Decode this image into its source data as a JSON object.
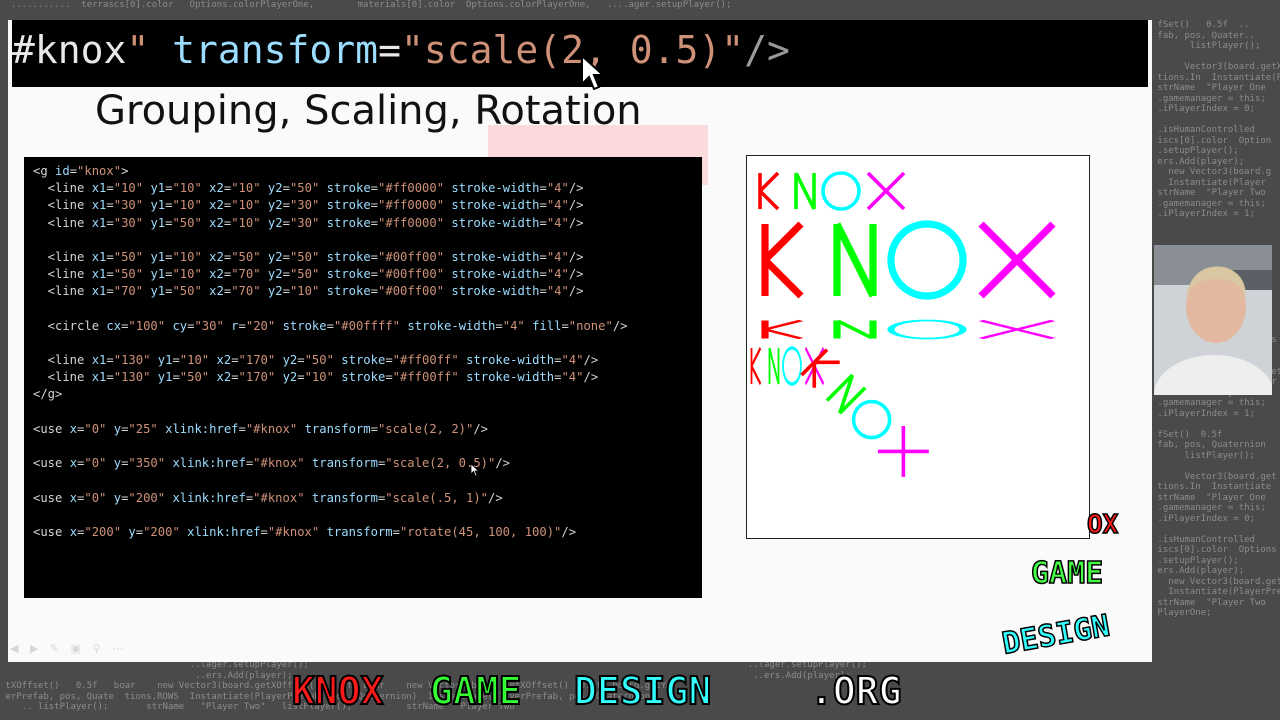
{
  "zoom": {
    "text_parts": [
      "#knox",
      "\"",
      " transform",
      "=",
      "\"scale(2, 0.5)\"",
      "/>"
    ]
  },
  "slide": {
    "title": "Grouping, Scaling, Rotation"
  },
  "code_lines": [
    [
      [
        "t",
        "<g "
      ],
      [
        "a",
        "id"
      ],
      [
        "t",
        "="
      ],
      [
        "s",
        "\"knox\""
      ],
      [
        "t",
        ">"
      ]
    ],
    [
      [
        "t",
        "  <line "
      ],
      [
        "a",
        "x1"
      ],
      [
        "t",
        "="
      ],
      [
        "s",
        "\"10\""
      ],
      [
        "t",
        " "
      ],
      [
        "a",
        "y1"
      ],
      [
        "t",
        "="
      ],
      [
        "s",
        "\"10\""
      ],
      [
        "t",
        " "
      ],
      [
        "a",
        "x2"
      ],
      [
        "t",
        "="
      ],
      [
        "s",
        "\"10\""
      ],
      [
        "t",
        " "
      ],
      [
        "a",
        "y2"
      ],
      [
        "t",
        "="
      ],
      [
        "s",
        "\"50\""
      ],
      [
        "t",
        " "
      ],
      [
        "a",
        "stroke"
      ],
      [
        "t",
        "="
      ],
      [
        "s",
        "\"#ff0000\""
      ],
      [
        "t",
        " "
      ],
      [
        "a",
        "stroke-width"
      ],
      [
        "t",
        "="
      ],
      [
        "s",
        "\"4\""
      ],
      [
        "t",
        "/>"
      ]
    ],
    [
      [
        "t",
        "  <line "
      ],
      [
        "a",
        "x1"
      ],
      [
        "t",
        "="
      ],
      [
        "s",
        "\"30\""
      ],
      [
        "t",
        " "
      ],
      [
        "a",
        "y1"
      ],
      [
        "t",
        "="
      ],
      [
        "s",
        "\"10\""
      ],
      [
        "t",
        " "
      ],
      [
        "a",
        "x2"
      ],
      [
        "t",
        "="
      ],
      [
        "s",
        "\"10\""
      ],
      [
        "t",
        " "
      ],
      [
        "a",
        "y2"
      ],
      [
        "t",
        "="
      ],
      [
        "s",
        "\"30\""
      ],
      [
        "t",
        " "
      ],
      [
        "a",
        "stroke"
      ],
      [
        "t",
        "="
      ],
      [
        "s",
        "\"#ff0000\""
      ],
      [
        "t",
        " "
      ],
      [
        "a",
        "stroke-width"
      ],
      [
        "t",
        "="
      ],
      [
        "s",
        "\"4\""
      ],
      [
        "t",
        "/>"
      ]
    ],
    [
      [
        "t",
        "  <line "
      ],
      [
        "a",
        "x1"
      ],
      [
        "t",
        "="
      ],
      [
        "s",
        "\"30\""
      ],
      [
        "t",
        " "
      ],
      [
        "a",
        "y1"
      ],
      [
        "t",
        "="
      ],
      [
        "s",
        "\"50\""
      ],
      [
        "t",
        " "
      ],
      [
        "a",
        "x2"
      ],
      [
        "t",
        "="
      ],
      [
        "s",
        "\"10\""
      ],
      [
        "t",
        " "
      ],
      [
        "a",
        "y2"
      ],
      [
        "t",
        "="
      ],
      [
        "s",
        "\"30\""
      ],
      [
        "t",
        " "
      ],
      [
        "a",
        "stroke"
      ],
      [
        "t",
        "="
      ],
      [
        "s",
        "\"#ff0000\""
      ],
      [
        "t",
        " "
      ],
      [
        "a",
        "stroke-width"
      ],
      [
        "t",
        "="
      ],
      [
        "s",
        "\"4\""
      ],
      [
        "t",
        "/>"
      ]
    ],
    [],
    [
      [
        "t",
        "  <line "
      ],
      [
        "a",
        "x1"
      ],
      [
        "t",
        "="
      ],
      [
        "s",
        "\"50\""
      ],
      [
        "t",
        " "
      ],
      [
        "a",
        "y1"
      ],
      [
        "t",
        "="
      ],
      [
        "s",
        "\"10\""
      ],
      [
        "t",
        " "
      ],
      [
        "a",
        "x2"
      ],
      [
        "t",
        "="
      ],
      [
        "s",
        "\"50\""
      ],
      [
        "t",
        " "
      ],
      [
        "a",
        "y2"
      ],
      [
        "t",
        "="
      ],
      [
        "s",
        "\"50\""
      ],
      [
        "t",
        " "
      ],
      [
        "a",
        "stroke"
      ],
      [
        "t",
        "="
      ],
      [
        "s",
        "\"#00ff00\""
      ],
      [
        "t",
        " "
      ],
      [
        "a",
        "stroke-width"
      ],
      [
        "t",
        "="
      ],
      [
        "s",
        "\"4\""
      ],
      [
        "t",
        "/>"
      ]
    ],
    [
      [
        "t",
        "  <line "
      ],
      [
        "a",
        "x1"
      ],
      [
        "t",
        "="
      ],
      [
        "s",
        "\"50\""
      ],
      [
        "t",
        " "
      ],
      [
        "a",
        "y1"
      ],
      [
        "t",
        "="
      ],
      [
        "s",
        "\"10\""
      ],
      [
        "t",
        " "
      ],
      [
        "a",
        "x2"
      ],
      [
        "t",
        "="
      ],
      [
        "s",
        "\"70\""
      ],
      [
        "t",
        " "
      ],
      [
        "a",
        "y2"
      ],
      [
        "t",
        "="
      ],
      [
        "s",
        "\"50\""
      ],
      [
        "t",
        " "
      ],
      [
        "a",
        "stroke"
      ],
      [
        "t",
        "="
      ],
      [
        "s",
        "\"#00ff00\""
      ],
      [
        "t",
        " "
      ],
      [
        "a",
        "stroke-width"
      ],
      [
        "t",
        "="
      ],
      [
        "s",
        "\"4\""
      ],
      [
        "t",
        "/>"
      ]
    ],
    [
      [
        "t",
        "  <line "
      ],
      [
        "a",
        "x1"
      ],
      [
        "t",
        "="
      ],
      [
        "s",
        "\"70\""
      ],
      [
        "t",
        " "
      ],
      [
        "a",
        "y1"
      ],
      [
        "t",
        "="
      ],
      [
        "s",
        "\"50\""
      ],
      [
        "t",
        " "
      ],
      [
        "a",
        "x2"
      ],
      [
        "t",
        "="
      ],
      [
        "s",
        "\"70\""
      ],
      [
        "t",
        " "
      ],
      [
        "a",
        "y2"
      ],
      [
        "t",
        "="
      ],
      [
        "s",
        "\"10\""
      ],
      [
        "t",
        " "
      ],
      [
        "a",
        "stroke"
      ],
      [
        "t",
        "="
      ],
      [
        "s",
        "\"#00ff00\""
      ],
      [
        "t",
        " "
      ],
      [
        "a",
        "stroke-width"
      ],
      [
        "t",
        "="
      ],
      [
        "s",
        "\"4\""
      ],
      [
        "t",
        "/>"
      ]
    ],
    [],
    [
      [
        "t",
        "  <circle "
      ],
      [
        "a",
        "cx"
      ],
      [
        "t",
        "="
      ],
      [
        "s",
        "\"100\""
      ],
      [
        "t",
        " "
      ],
      [
        "a",
        "cy"
      ],
      [
        "t",
        "="
      ],
      [
        "s",
        "\"30\""
      ],
      [
        "t",
        " "
      ],
      [
        "a",
        "r"
      ],
      [
        "t",
        "="
      ],
      [
        "s",
        "\"20\""
      ],
      [
        "t",
        " "
      ],
      [
        "a",
        "stroke"
      ],
      [
        "t",
        "="
      ],
      [
        "s",
        "\"#00ffff\""
      ],
      [
        "t",
        " "
      ],
      [
        "a",
        "stroke-width"
      ],
      [
        "t",
        "="
      ],
      [
        "s",
        "\"4\""
      ],
      [
        "t",
        " "
      ],
      [
        "a",
        "fill"
      ],
      [
        "t",
        "="
      ],
      [
        "s",
        "\"none\""
      ],
      [
        "t",
        "/>"
      ]
    ],
    [],
    [
      [
        "t",
        "  <line "
      ],
      [
        "a",
        "x1"
      ],
      [
        "t",
        "="
      ],
      [
        "s",
        "\"130\""
      ],
      [
        "t",
        " "
      ],
      [
        "a",
        "y1"
      ],
      [
        "t",
        "="
      ],
      [
        "s",
        "\"10\""
      ],
      [
        "t",
        " "
      ],
      [
        "a",
        "x2"
      ],
      [
        "t",
        "="
      ],
      [
        "s",
        "\"170\""
      ],
      [
        "t",
        " "
      ],
      [
        "a",
        "y2"
      ],
      [
        "t",
        "="
      ],
      [
        "s",
        "\"50\""
      ],
      [
        "t",
        " "
      ],
      [
        "a",
        "stroke"
      ],
      [
        "t",
        "="
      ],
      [
        "s",
        "\"#ff00ff\""
      ],
      [
        "t",
        " "
      ],
      [
        "a",
        "stroke-width"
      ],
      [
        "t",
        "="
      ],
      [
        "s",
        "\"4\""
      ],
      [
        "t",
        "/>"
      ]
    ],
    [
      [
        "t",
        "  <line "
      ],
      [
        "a",
        "x1"
      ],
      [
        "t",
        "="
      ],
      [
        "s",
        "\"130\""
      ],
      [
        "t",
        " "
      ],
      [
        "a",
        "y1"
      ],
      [
        "t",
        "="
      ],
      [
        "s",
        "\"50\""
      ],
      [
        "t",
        " "
      ],
      [
        "a",
        "x2"
      ],
      [
        "t",
        "="
      ],
      [
        "s",
        "\"170\""
      ],
      [
        "t",
        " "
      ],
      [
        "a",
        "y2"
      ],
      [
        "t",
        "="
      ],
      [
        "s",
        "\"10\""
      ],
      [
        "t",
        " "
      ],
      [
        "a",
        "stroke"
      ],
      [
        "t",
        "="
      ],
      [
        "s",
        "\"#ff00ff\""
      ],
      [
        "t",
        " "
      ],
      [
        "a",
        "stroke-width"
      ],
      [
        "t",
        "="
      ],
      [
        "s",
        "\"4\""
      ],
      [
        "t",
        "/>"
      ]
    ],
    [
      [
        "t",
        "</g>"
      ]
    ],
    [],
    [
      [
        "t",
        "<use "
      ],
      [
        "a",
        "x"
      ],
      [
        "t",
        "="
      ],
      [
        "s",
        "\"0\""
      ],
      [
        "t",
        " "
      ],
      [
        "a",
        "y"
      ],
      [
        "t",
        "="
      ],
      [
        "s",
        "\"25\""
      ],
      [
        "t",
        " "
      ],
      [
        "a",
        "xlink:href"
      ],
      [
        "t",
        "="
      ],
      [
        "s",
        "\"#knox\""
      ],
      [
        "t",
        " "
      ],
      [
        "a",
        "transform"
      ],
      [
        "t",
        "="
      ],
      [
        "s",
        "\"scale(2, 2)\""
      ],
      [
        "t",
        "/>"
      ]
    ],
    [],
    [
      [
        "t",
        "<use "
      ],
      [
        "a",
        "x"
      ],
      [
        "t",
        "="
      ],
      [
        "s",
        "\"0\""
      ],
      [
        "t",
        " "
      ],
      [
        "a",
        "y"
      ],
      [
        "t",
        "="
      ],
      [
        "s",
        "\"350\""
      ],
      [
        "t",
        " "
      ],
      [
        "a",
        "xlink:href"
      ],
      [
        "t",
        "="
      ],
      [
        "s",
        "\"#knox\""
      ],
      [
        "t",
        " "
      ],
      [
        "a",
        "transform"
      ],
      [
        "t",
        "="
      ],
      [
        "s",
        "\"scale(2, 0.5)\""
      ],
      [
        "t",
        "/>"
      ]
    ],
    [],
    [
      [
        "t",
        "<use "
      ],
      [
        "a",
        "x"
      ],
      [
        "t",
        "="
      ],
      [
        "s",
        "\"0\""
      ],
      [
        "t",
        " "
      ],
      [
        "a",
        "y"
      ],
      [
        "t",
        "="
      ],
      [
        "s",
        "\"200\""
      ],
      [
        "t",
        " "
      ],
      [
        "a",
        "xlink:href"
      ],
      [
        "t",
        "="
      ],
      [
        "s",
        "\"#knox\""
      ],
      [
        "t",
        " "
      ],
      [
        "a",
        "transform"
      ],
      [
        "t",
        "="
      ],
      [
        "s",
        "\"scale(.5, 1)\""
      ],
      [
        "t",
        "/>"
      ]
    ],
    [],
    [
      [
        "t",
        "<use "
      ],
      [
        "a",
        "x"
      ],
      [
        "t",
        "="
      ],
      [
        "s",
        "\"200\""
      ],
      [
        "t",
        " "
      ],
      [
        "a",
        "y"
      ],
      [
        "t",
        "="
      ],
      [
        "s",
        "\"200\""
      ],
      [
        "t",
        " "
      ],
      [
        "a",
        "xlink:href"
      ],
      [
        "t",
        "="
      ],
      [
        "s",
        "\"#knox\""
      ],
      [
        "t",
        " "
      ],
      [
        "a",
        "transform"
      ],
      [
        "t",
        "="
      ],
      [
        "s",
        "\"rotate(45, 100, 100)\""
      ],
      [
        "t",
        "/>"
      ]
    ]
  ],
  "logo": {
    "line1": "OX",
    "line2": "GAME",
    "line3": "DESIGN"
  },
  "footer": {
    "part_knox": "KNOX",
    "part_game": "GAME",
    "part_design": "DESIGN",
    "part_org": ".ORG"
  },
  "colors": {
    "red": "#ff0000",
    "green": "#00ff00",
    "cyan": "#00ffff",
    "magenta": "#ff00ff"
  },
  "icons": {
    "cursor": "arrow-cursor-icon"
  }
}
